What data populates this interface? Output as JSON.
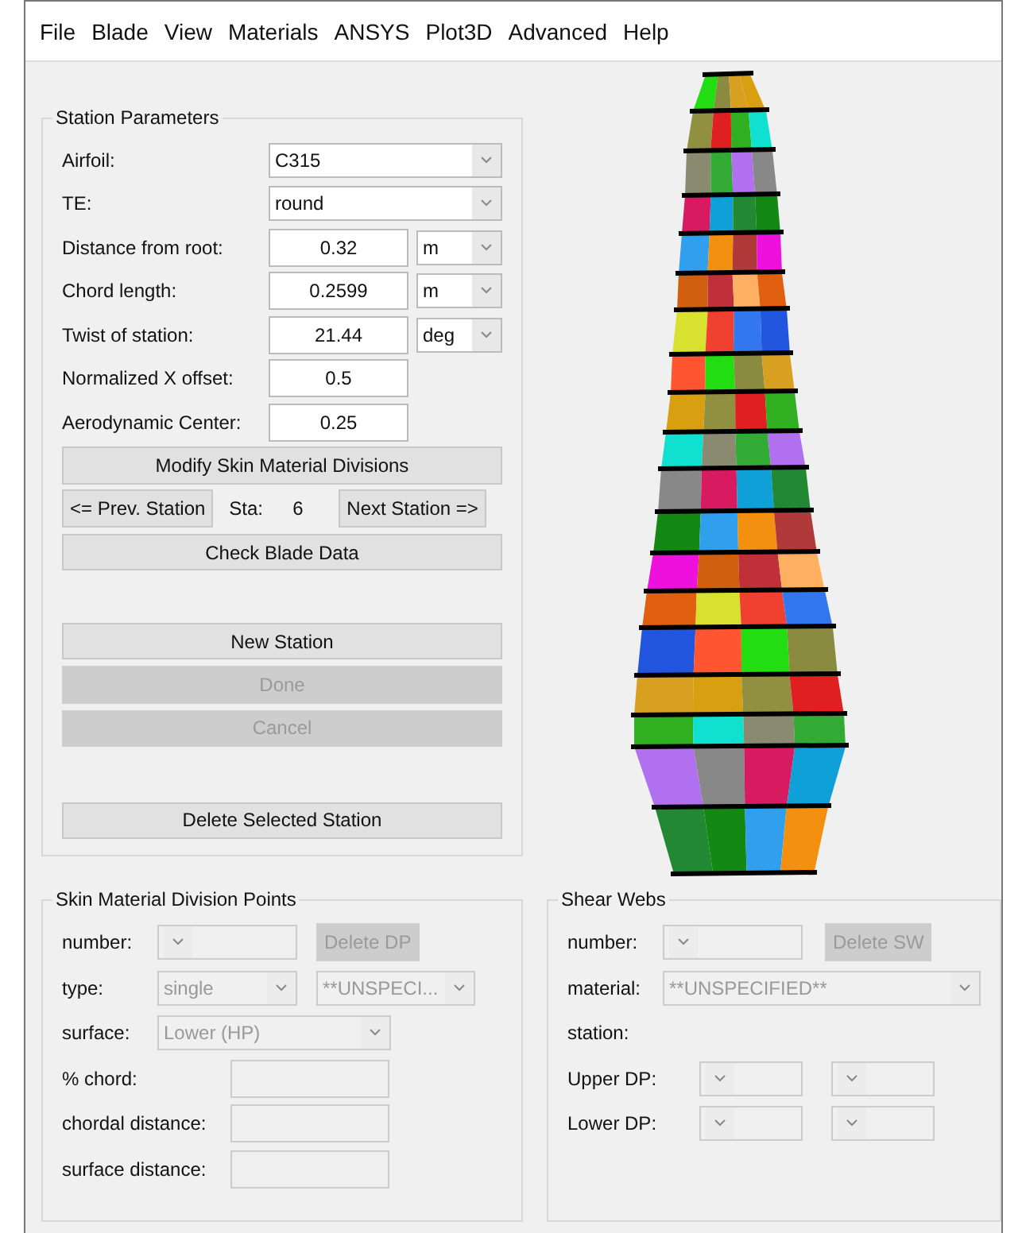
{
  "menu": [
    "File",
    "Blade",
    "View",
    "Materials",
    "ANSYS",
    "Plot3D",
    "Advanced",
    "Help"
  ],
  "station_parameters": {
    "title": "Station Parameters",
    "fields": [
      {
        "kind": "dropdown",
        "label": "Airfoil:",
        "value": "C315"
      },
      {
        "kind": "dropdown",
        "label": "TE:",
        "value": "round"
      },
      {
        "kind": "unit",
        "label": "Distance from root:",
        "value": "0.32",
        "unit": "m"
      },
      {
        "kind": "unit",
        "label": "Chord length:",
        "value": "0.2599",
        "unit": "m"
      },
      {
        "kind": "unit",
        "label": "Twist of station:",
        "value": "21.44",
        "unit": "deg"
      },
      {
        "kind": "input",
        "label": "Normalized X offset:",
        "value": "0.5"
      },
      {
        "kind": "input",
        "label": "Aerodynamic Center:",
        "value": "0.25"
      }
    ],
    "modify_button": {
      "label": "Modify Skin Material Divisions",
      "disabled": false
    },
    "prev_button": {
      "label": "<= Prev. Station",
      "disabled": false
    },
    "sta_label": "Sta:",
    "sta_value": "6",
    "next_button": {
      "label": "Next Station =>",
      "disabled": false
    },
    "check_button": {
      "label": "Check Blade Data",
      "disabled": false
    },
    "action_buttons": [
      {
        "label": "New Station",
        "disabled": false
      },
      {
        "label": "Done",
        "disabled": true
      },
      {
        "label": "Cancel",
        "disabled": true
      }
    ],
    "delete_button": {
      "label": "Delete Selected Station",
      "disabled": false
    }
  },
  "skin_division_points": {
    "title": "Skin Material Division Points",
    "number": {
      "label": "number:",
      "disabled": true
    },
    "delete_button": {
      "label": "Delete DP",
      "disabled": true
    },
    "type": {
      "label": "type:",
      "value": "single",
      "disabled": true
    },
    "material": {
      "value": "**UNSPECI...",
      "disabled": true
    },
    "surface": {
      "label": "surface:",
      "value": "Lower (HP)",
      "disabled": true
    },
    "inputs": [
      {
        "label": "% chord:"
      },
      {
        "label": "chordal distance:"
      },
      {
        "label": "surface distance:"
      }
    ]
  },
  "shear_webs": {
    "title": "Shear Webs",
    "number": {
      "label": "number:",
      "disabled": true
    },
    "delete_button": {
      "label": "Delete SW",
      "disabled": true
    },
    "material": {
      "label": "material:",
      "value": "**UNSPECIFIED**",
      "disabled": true
    },
    "station_label": "station:",
    "dp_rows": [
      {
        "label": "Upper DP:",
        "disabled": true
      },
      {
        "label": "Lower DP:",
        "disabled": true
      }
    ]
  }
}
